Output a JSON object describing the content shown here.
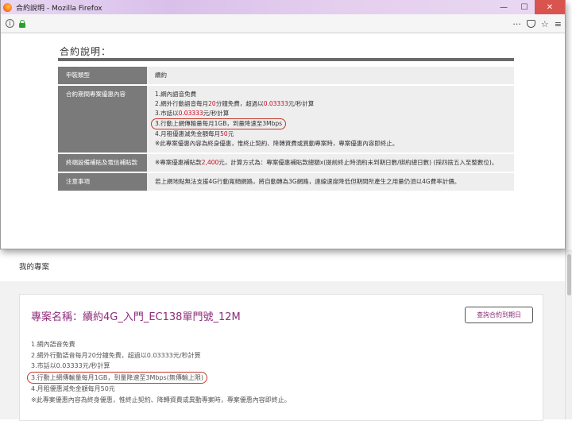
{
  "window": {
    "title": "合約說明 - Mozilla Firefox"
  },
  "window_buttons": {
    "minimize": "—",
    "maximize": "☐",
    "close": "✕"
  },
  "toolbar": {
    "more": "···",
    "star": "☆",
    "menu": "≡"
  },
  "popup": {
    "heading": "合約說明：",
    "rows": [
      {
        "label": "申裝類型",
        "lines": [
          "續約"
        ]
      },
      {
        "label": "合約期間專案優惠內容",
        "lines": [
          "1.網內語音免費",
          {
            "pre": "2.網外行動語音每月",
            "red1": "20",
            "mid": "分鐘免費，超過以",
            "red2": "0.03333",
            "post": "元/秒計算"
          },
          {
            "pre": "3.市話以",
            "red1": "0.03333",
            "post": "元/秒計算"
          },
          "3.行動上網傳輸量每月1GB，到量降速至3Mbps",
          {
            "pre": "4.月租優惠減免金額每月",
            "red1": "50",
            "post": "元"
          },
          "※此專案優惠內容為終身優惠，惟終止契約、降轉資費或異動專案時，專案優惠內容即終止。"
        ]
      },
      {
        "label": "終端設備補貼及電信補貼款",
        "pre": "※專案優惠補貼款",
        "red": "2,400",
        "post": "元，計算方式為：專案優惠補貼款總額x(提前終止時須約未到期日數/綁約總日數) (採四捨五入至整數位)。"
      },
      {
        "label": "注意事項",
        "text": "若上網地點無法支援4G行動寬頻網路，將自動轉為3G網路，連線速度降低但期間所產生之用量仍須以4G費率計價。"
      }
    ]
  },
  "page": {
    "section_title": "我的專案",
    "plan_name": "專案名稱：續約4G_入門_EC138單門號_12M",
    "query_button": "查詢合約到期日",
    "items": [
      "1.網內語音免費",
      "2.網外行動語音每月20分鐘免費，超過以0.03333元/秒計算",
      "3.市話以0.03333元/秒計算",
      "3.行動上網傳輸量每月1GB，到量降速至3Mbps(無傳輸上限)",
      "4.月租優惠減免金額每月50元",
      "※此專案優惠內容為終身優惠，惟終止契約、降轉資費或異動專案時，專案優惠內容即終止。"
    ]
  },
  "colors": {
    "accent": "#8e2a7a",
    "highlight_red": "#d0021b",
    "label_bg": "#7a7a7a",
    "content_bg": "#eeeeee"
  },
  "icons": [
    "firefox-logo-icon",
    "info-icon",
    "lock-icon",
    "more-icon",
    "pocket-icon",
    "star-icon",
    "menu-icon",
    "close-icon"
  ]
}
